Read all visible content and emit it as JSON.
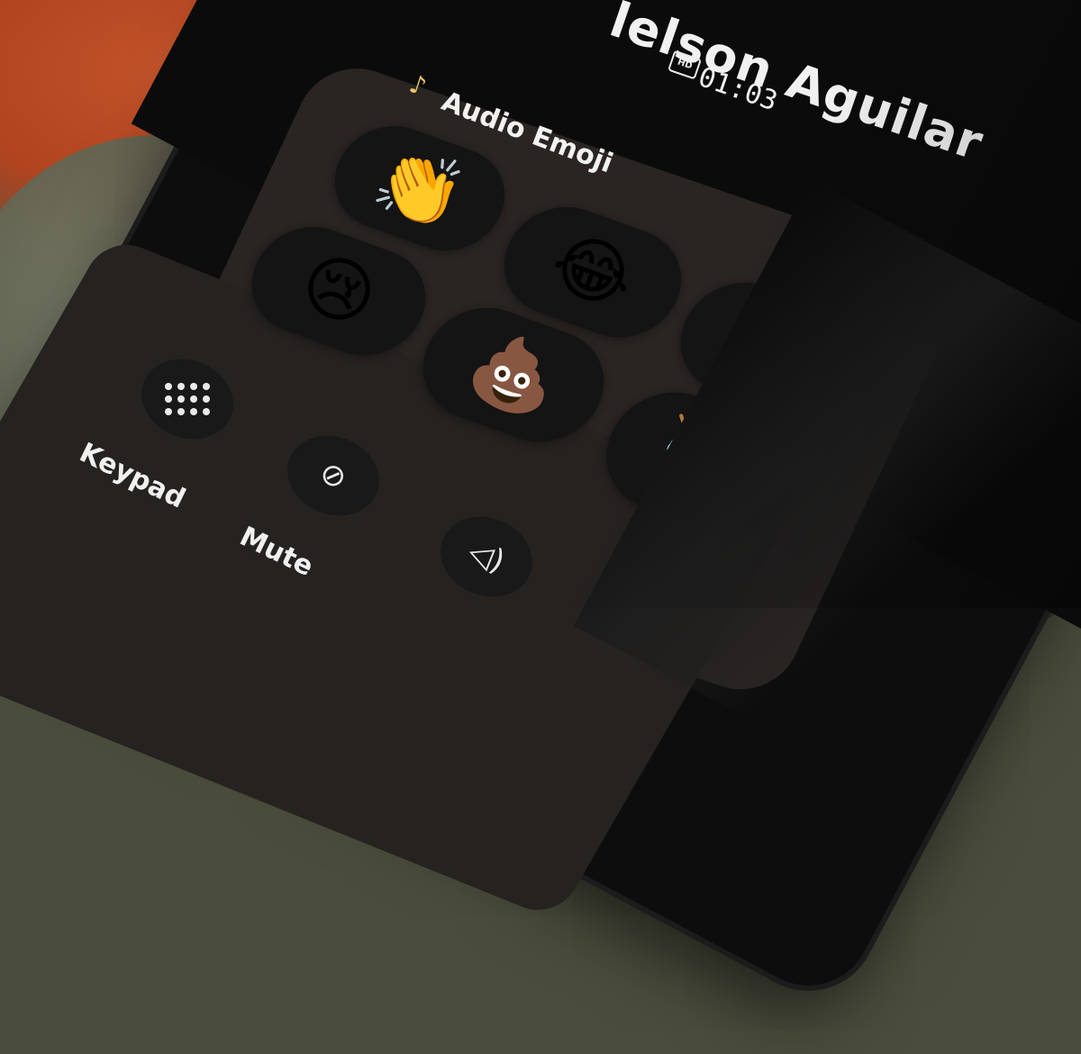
{
  "call": {
    "caller_name": "lelson Aguilar",
    "hd_badge": "HD",
    "duration": "01:03"
  },
  "audio_emoji_panel": {
    "title": "Audio Emoji",
    "title_icon": "music-note-icon",
    "close_icon": "close-icon",
    "emojis": [
      {
        "name": "clapping-hands",
        "glyph": "👏"
      },
      {
        "name": "crying-face",
        "glyph": "😢"
      },
      {
        "name": "laughing-tears",
        "glyph": "😂"
      },
      {
        "name": "party-popper",
        "glyph": "🎉"
      },
      {
        "name": "pile-of-poo",
        "glyph": "💩"
      },
      {
        "name": "drum",
        "glyph": "🥁"
      }
    ]
  },
  "controls": {
    "keypad_label": "Keypad",
    "mute_label": "Mute",
    "keypad_icon": "keypad-icon",
    "mute_icon": "mic-off-icon",
    "speaker_icon": "speaker-icon"
  },
  "colors": {
    "screen_bg": "#0b0b0b",
    "panel_bg": "#2a2523",
    "button_bg": "#141414",
    "note_icon": "#e8c46a",
    "text": "#f0f0f0"
  }
}
